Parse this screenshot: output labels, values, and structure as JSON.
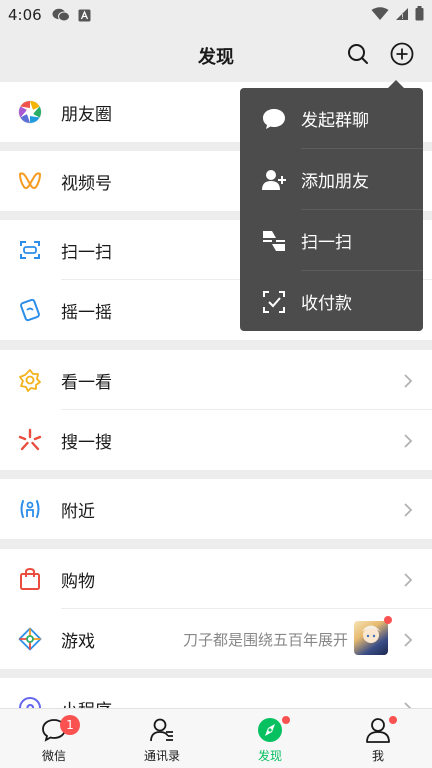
{
  "status_bar": {
    "time": "4:06"
  },
  "header": {
    "title": "发现"
  },
  "rows": {
    "moments": "朋友圈",
    "channels": "视频号",
    "scan": "扫一扫",
    "shake": "摇一摇",
    "top_stories": "看一看",
    "search": "搜一搜",
    "nearby": "附近",
    "shopping": "购物",
    "games": "游戏",
    "games_subtitle": "刀子都是围绕五百年展开",
    "mini_programs": "小程序"
  },
  "popup_menu": {
    "items": [
      "发起群聊",
      "添加朋友",
      "扫一扫",
      "收付款"
    ]
  },
  "tabbar": {
    "tabs": [
      "微信",
      "通讯录",
      "发现",
      "我"
    ],
    "chats_badge": "1",
    "active_color": "#07c160"
  },
  "icons": {
    "status": [
      "wechat-icon",
      "a-notification-icon",
      "wifi-icon",
      "signal-icon",
      "battery-icon"
    ],
    "header": [
      "search-icon",
      "plus-circle-icon"
    ]
  }
}
